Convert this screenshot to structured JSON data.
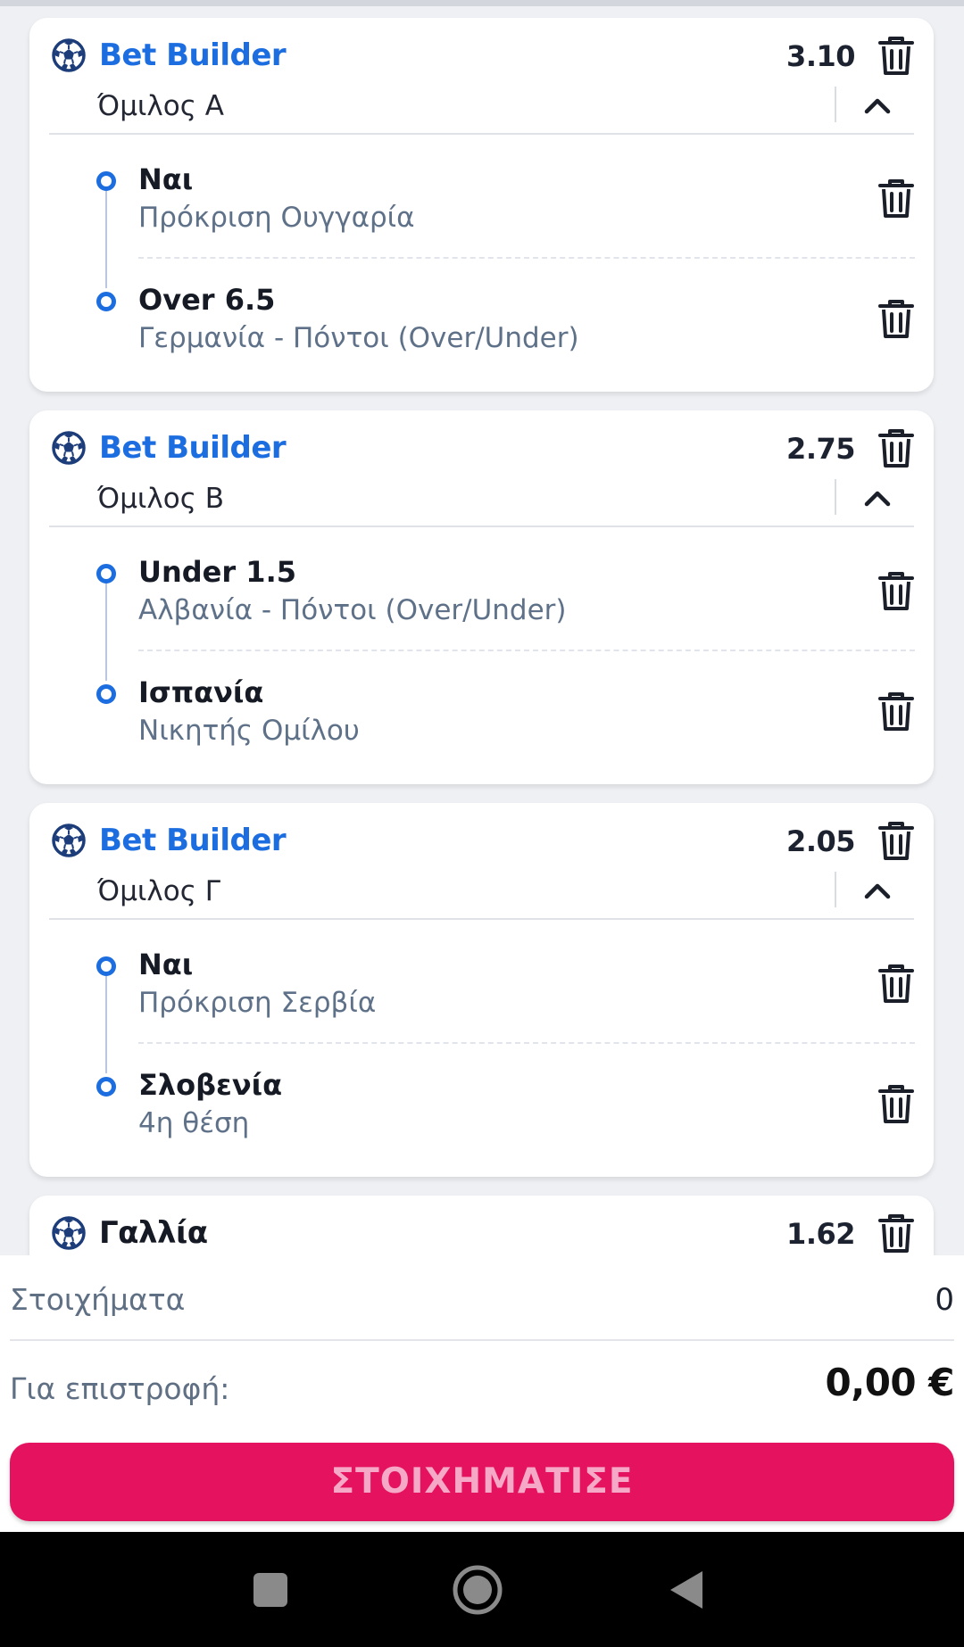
{
  "colors": {
    "accent": "#1c6de0",
    "bet_button": "#e5135f",
    "page_bg": "#eef0f4"
  },
  "icons": {
    "card": "soccer-ball-icon",
    "delete": "trash-icon",
    "collapse": "chevron-up-icon"
  },
  "cards": [
    {
      "title": "Bet Builder",
      "odds": "3.10",
      "group": "Όμιλος Α",
      "selections": [
        {
          "pick": "Ναι",
          "market": "Πρόκριση Ουγγαρία"
        },
        {
          "pick": "Over 6.5",
          "market": "Γερμανία - Πόντοι (Over/Under)"
        }
      ]
    },
    {
      "title": "Bet Builder",
      "odds": "2.75",
      "group": "Όμιλος Β",
      "selections": [
        {
          "pick": "Under 1.5",
          "market": "Αλβανία - Πόντοι (Over/Under)"
        },
        {
          "pick": "Ισπανία",
          "market": "Νικητής Ομίλου"
        }
      ]
    },
    {
      "title": "Bet Builder",
      "odds": "2.05",
      "group": "Όμιλος Γ",
      "selections": [
        {
          "pick": "Ναι",
          "market": "Πρόκριση Σερβία"
        },
        {
          "pick": "Σλοβενία",
          "market": "4η θέση"
        }
      ]
    },
    {
      "title": "Γαλλία",
      "odds": "1.62"
    }
  ],
  "footer": {
    "bets_label": "Στοιχήματα",
    "bets_count": "0",
    "return_label": "Για επιστροφή:",
    "return_amount": "0,00 €",
    "submit_label": "ΣΤΟΙΧΗΜΑΤΙΣΕ"
  },
  "navbar": {
    "buttons": [
      "recents-button",
      "home-button",
      "back-button"
    ]
  }
}
